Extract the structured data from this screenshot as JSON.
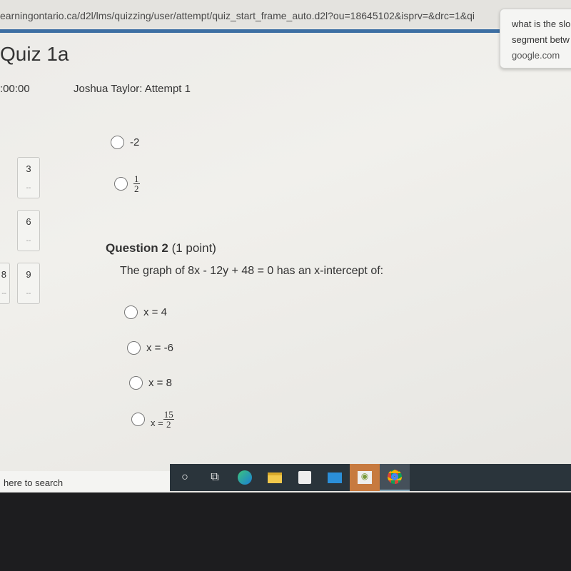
{
  "browser": {
    "url": "earningontario.ca/d2l/lms/quizzing/user/attempt/quiz_start_frame_auto.d2l?ou=18645102&isprv=&drc=1&qi",
    "suggestion": {
      "line1": "what is the slo",
      "line2": "segment betw",
      "source": "google.com"
    }
  },
  "quiz": {
    "title": "Quiz 1a",
    "timer": ":00:00",
    "attempt": "Joshua Taylor: Attempt 1"
  },
  "nav": {
    "boxes": [
      {
        "label": "3"
      },
      {
        "label": "6"
      },
      {
        "label": "8"
      },
      {
        "label": "9"
      }
    ],
    "dash": "--"
  },
  "question1": {
    "options": [
      {
        "label": "-2"
      },
      {
        "num": "1",
        "den": "2"
      }
    ]
  },
  "question2": {
    "title": "Question 2",
    "points": "(1 point)",
    "text": "The graph of 8x - 12y + 48 = 0  has an x-intercept of:",
    "options": [
      {
        "label": "x = 4"
      },
      {
        "label": "x = -6"
      },
      {
        "label": "x = 8"
      },
      {
        "prefix": "x = ",
        "num": "15",
        "den": "2"
      }
    ]
  },
  "taskbar": {
    "search_placeholder": "here to search",
    "icons": [
      "cortana-icon",
      "task-view-icon",
      "edge-icon",
      "file-explorer-icon",
      "store-icon",
      "mail-icon",
      "eye-app-icon",
      "chrome-icon"
    ]
  }
}
